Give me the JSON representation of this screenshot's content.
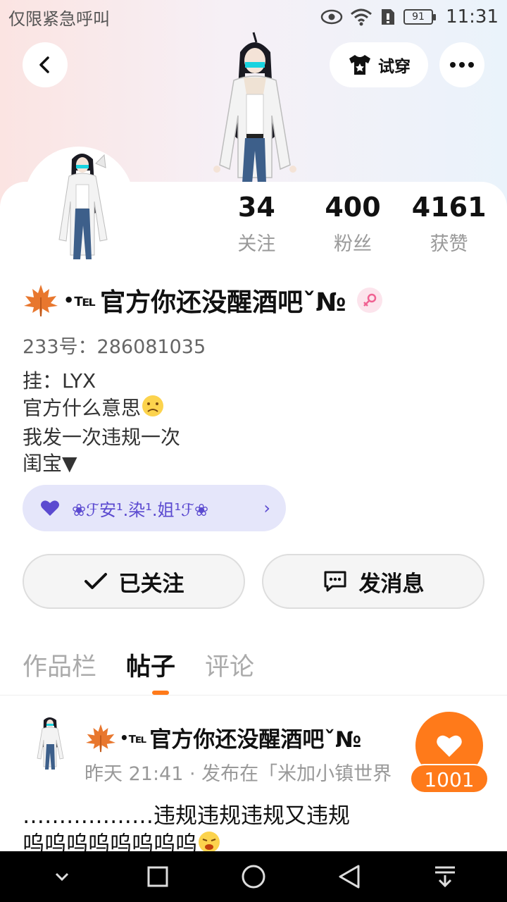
{
  "status_bar": {
    "carrier": "仅限紧急呼叫",
    "battery": "91",
    "time": "11:31"
  },
  "header": {
    "try_on_label": "试穿",
    "back_icon": "chevron-left-icon",
    "more_icon": "more-dots-icon"
  },
  "profile": {
    "stats": [
      {
        "value": "34",
        "label": "关注"
      },
      {
        "value": "400",
        "label": "粉丝"
      },
      {
        "value": "4161",
        "label": "获赞"
      }
    ],
    "username_prefix": "•℡",
    "username": "官方你还没醒酒吧ˇ№",
    "uid": "233号：286081035",
    "bio": [
      "挂：LYX",
      "官方什么意思",
      "我发一次违规一次",
      "闺宝▼"
    ],
    "medal_text": "❀ℱ安¹.染¹.姐¹ℱ❀"
  },
  "actions": {
    "follow_label": "已关注",
    "message_label": "发消息"
  },
  "tabs": [
    {
      "label": "作品栏",
      "active": false
    },
    {
      "label": "帖子",
      "active": true
    },
    {
      "label": "评论",
      "active": false
    }
  ],
  "post": {
    "author_prefix": "•℡",
    "author": "官方你还没醒酒吧ˇ№",
    "meta": "昨天 21:41 · 发布在「米加小镇世界",
    "like_count": "1001",
    "body": [
      "………………违规违规违规又违规",
      "呜呜呜呜呜呜呜呜"
    ]
  },
  "colors": {
    "accent": "#ff7a1a",
    "medal_bg": "#e5e6fa",
    "medal_text": "#5b4ad0"
  }
}
